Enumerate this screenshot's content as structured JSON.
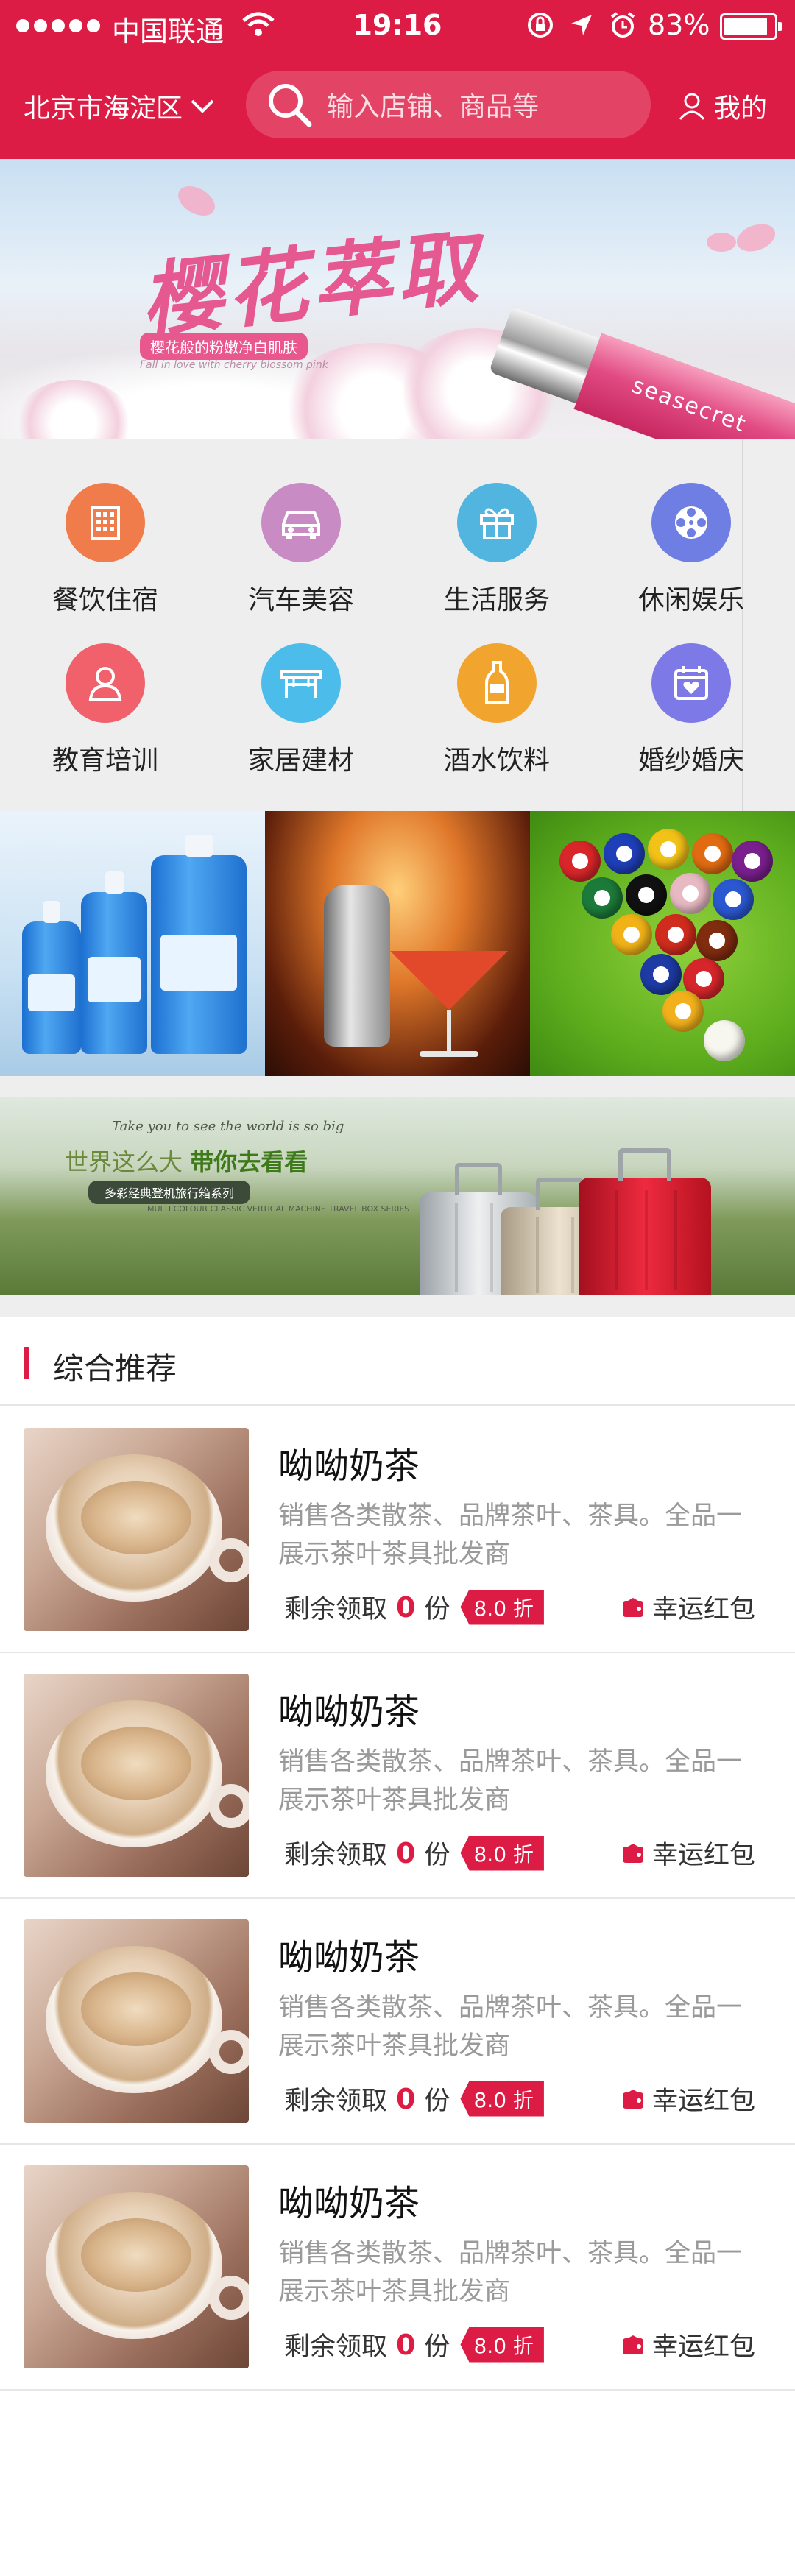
{
  "status_bar": {
    "carrier": "中国联通",
    "time": "19:16",
    "battery": "83%"
  },
  "header": {
    "city": "北京市海淀区",
    "search_placeholder": "输入店铺、商品等",
    "mine": "我的",
    "brand_color": "#dd1c45"
  },
  "banner": {
    "title": "樱花萃取",
    "subtitle": "樱花般的粉嫩净白肌肤",
    "tagline": "Fall in love with cherry blossom pink",
    "product_brand": "seasecret"
  },
  "categories": [
    {
      "label": "餐饮住宿",
      "icon": "building-icon",
      "color": "#f07c4b"
    },
    {
      "label": "汽车美容",
      "icon": "car-icon",
      "color": "#c88bc4"
    },
    {
      "label": "生活服务",
      "icon": "gift-icon",
      "color": "#52b5e0"
    },
    {
      "label": "休闲娱乐",
      "icon": "film-reel-icon",
      "color": "#6f7ee2"
    },
    {
      "label": "教育培训",
      "icon": "person-icon",
      "color": "#f0616c"
    },
    {
      "label": "家居建材",
      "icon": "table-icon",
      "color": "#4cbcea"
    },
    {
      "label": "酒水饮料",
      "icon": "bottle-icon",
      "color": "#f2a52e"
    },
    {
      "label": "婚纱婚庆",
      "icon": "calendar-heart-icon",
      "color": "#7d79e6"
    }
  ],
  "promo_tiles": [
    {
      "name": "detergent-tile"
    },
    {
      "name": "cocktail-tile"
    },
    {
      "name": "billiards-tile"
    }
  ],
  "luggage_banner": {
    "en_line": "Take you to see the world is so big",
    "slogan_part1": "世界这么大",
    "slogan_part2": "带你去看看",
    "pill": "多彩经典登机旅行箱系列",
    "small_en": "MULTI COLOUR CLASSIC VERTICAL MACHINE TRAVEL BOX SERIES"
  },
  "section": {
    "title": "综合推荐"
  },
  "items": [
    {
      "name": "呦呦奶茶",
      "desc": "销售各类散茶、品牌茶叶、茶具。全品一展示茶叶茶具批发商",
      "remain_label": "剩余领取",
      "remain_count": "0",
      "unit": "份",
      "discount": "8.0 折",
      "lucky": "幸运红包"
    },
    {
      "name": "呦呦奶茶",
      "desc": "销售各类散茶、品牌茶叶、茶具。全品一展示茶叶茶具批发商",
      "remain_label": "剩余领取",
      "remain_count": "0",
      "unit": "份",
      "discount": "8.0 折",
      "lucky": "幸运红包"
    },
    {
      "name": "呦呦奶茶",
      "desc": "销售各类散茶、品牌茶叶、茶具。全品一展示茶叶茶具批发商",
      "remain_label": "剩余领取",
      "remain_count": "0",
      "unit": "份",
      "discount": "8.0 折",
      "lucky": "幸运红包"
    },
    {
      "name": "呦呦奶茶",
      "desc": "销售各类散茶、品牌茶叶、茶具。全品一展示茶叶茶具批发商",
      "remain_label": "剩余领取",
      "remain_count": "0",
      "unit": "份",
      "discount": "8.0 折",
      "lucky": "幸运红包"
    }
  ]
}
